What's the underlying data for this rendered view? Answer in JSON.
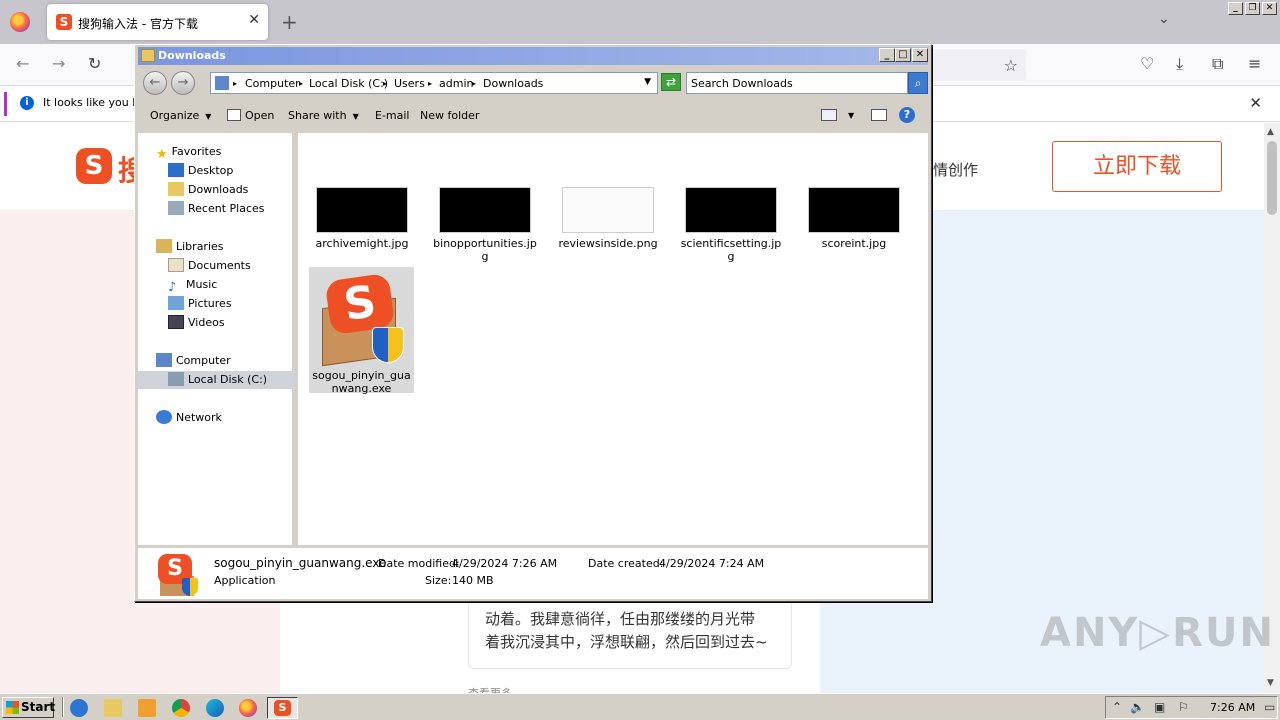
{
  "browser": {
    "tab_title": "搜狗输入法 - 官方下载",
    "tab_close": "✕",
    "new_tab": "+",
    "notification_text": "It looks like you ha",
    "notification_close": "✕",
    "window_controls": [
      "_",
      "❐",
      "✕"
    ]
  },
  "webpage": {
    "logo_letter": "S",
    "logo_text": "搜",
    "nav_text": "情创作",
    "download_button": "立即下载",
    "card_line1": "动着。我肆意徜徉，任由那缕缕的月光带",
    "card_line2": "着我沉浸其中，浮想联翩，然后回到过去~",
    "more_text": "查看更多",
    "watermark": "ANY▷RUN"
  },
  "explorer": {
    "title": "Downloads",
    "controls": [
      "_",
      "□",
      "✕"
    ],
    "breadcrumbs": [
      "Computer",
      "Local Disk (C:)",
      "Users",
      "admin",
      "Downloads"
    ],
    "search_placeholder": "Search Downloads",
    "toolbar": {
      "organize": "Organize",
      "open": "Open",
      "share_with": "Share with",
      "email": "E-mail",
      "new_folder": "New folder"
    },
    "nav": {
      "favorites": "Favorites",
      "desktop": "Desktop",
      "downloads": "Downloads",
      "recent_places": "Recent Places",
      "libraries": "Libraries",
      "documents": "Documents",
      "music": "Music",
      "pictures": "Pictures",
      "videos": "Videos",
      "computer": "Computer",
      "local_disk": "Local Disk (C:)",
      "network": "Network"
    },
    "files": [
      {
        "name": "archivemight.jpg"
      },
      {
        "name": "binopportunities.jpg"
      },
      {
        "name": "reviewsinside.png"
      },
      {
        "name": "scientificsetting.jpg"
      },
      {
        "name": "scoreint.jpg"
      },
      {
        "name": "sogou_pinyin_guanwang.exe"
      }
    ],
    "details": {
      "filename": "sogou_pinyin_guanwang.exe",
      "type": "Application",
      "date_modified_label": "Date modified:",
      "date_modified": "4/29/2024 7:26 AM",
      "date_created_label": "Date created:",
      "date_created": "4/29/2024 7:24 AM",
      "size_label": "Size:",
      "size": "140 MB"
    }
  },
  "taskbar": {
    "start_label": "Start",
    "clock": "7:26 AM"
  }
}
